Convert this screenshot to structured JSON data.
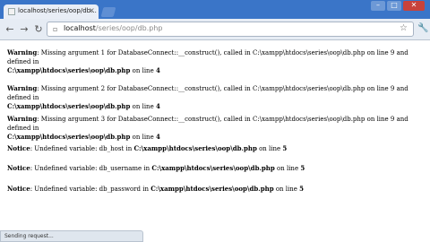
{
  "tab": {
    "title": "localhost/series/oop/db...",
    "close": "×"
  },
  "window": {
    "minimize": "–",
    "maximize": "□",
    "close": "✕"
  },
  "toolbar": {
    "back": "←",
    "forward": "→",
    "reload": "↻",
    "url_host": "localhost",
    "url_path": "/series/oop/db.php",
    "star": "☆",
    "wrench": "🔧"
  },
  "messages": [
    {
      "type": "Warning",
      "text": ": Missing argument 1 for DatabaseConnect::__construct(), called in C:\\xampp\\htdocs\\series\\oop\\db.php on line 9 and defined in",
      "file": "C:\\xampp\\htdocs\\series\\oop\\db.php",
      "line_text": " on line ",
      "line": "4"
    },
    {
      "type": "Warning",
      "text": ": Missing argument 2 for DatabaseConnect::__construct(), called in C:\\xampp\\htdocs\\series\\oop\\db.php on line 9 and defined in",
      "file": "C:\\xampp\\htdocs\\series\\oop\\db.php",
      "line_text": " on line ",
      "line": "4"
    },
    {
      "type": "Warning",
      "text": ": Missing argument 3 for DatabaseConnect::__construct(), called in C:\\xampp\\htdocs\\series\\oop\\db.php on line 9 and defined in",
      "file": "C:\\xampp\\htdocs\\series\\oop\\db.php",
      "line_text": " on line ",
      "line": "4"
    },
    {
      "type": "Notice",
      "text": ": Undefined variable: db_host in ",
      "file": "C:\\xampp\\htdocs\\series\\oop\\db.php",
      "line_text": " on line ",
      "line": "5"
    },
    {
      "type": "Notice",
      "text": ": Undefined variable: db_username in ",
      "file": "C:\\xampp\\htdocs\\series\\oop\\db.php",
      "line_text": " on line ",
      "line": "5"
    },
    {
      "type": "Notice",
      "text": ": Undefined variable: db_password in ",
      "file": "C:\\xampp\\htdocs\\series\\oop\\db.php",
      "line_text": " on line ",
      "line": "5"
    }
  ],
  "status": {
    "text": "Sending request..."
  }
}
